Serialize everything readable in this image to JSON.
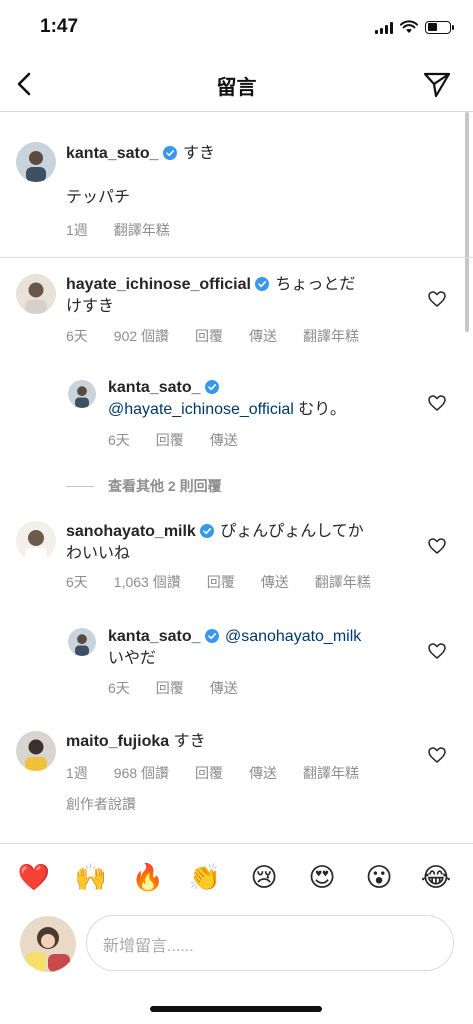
{
  "status_bar": {
    "time": "1:47"
  },
  "header": {
    "title": "留言"
  },
  "caption": {
    "username": "kanta_sato_",
    "text": "すき",
    "body": "テッパチ",
    "time": "1週",
    "translate": "翻譯年糕"
  },
  "comments": [
    {
      "username": "hayate_ichinose_official",
      "text_line1": "ちょっとだ",
      "text_line2": "けすき",
      "time": "6天",
      "likes": "902 個讚",
      "reply": "回覆",
      "send": "傳送",
      "translate": "翻譯年糕"
    },
    {
      "username": "kanta_sato_",
      "mention": "@hayate_ichinose_official",
      "text": "むり。",
      "time": "6天",
      "reply": "回覆",
      "send": "傳送"
    },
    {
      "username": "sanohayato_milk",
      "text_line1": "ぴょんぴょんしてか",
      "text_line2": "わいいね",
      "time": "6天",
      "likes": "1,063 個讚",
      "reply": "回覆",
      "send": "傳送",
      "translate": "翻譯年糕"
    },
    {
      "username": "kanta_sato_",
      "mention": "@sanohayato_milk",
      "text": "いやだ",
      "time": "6天",
      "reply": "回覆",
      "send": "傳送"
    },
    {
      "username": "maito_fujioka",
      "text": "すき",
      "time": "1週",
      "likes": "968 個讚",
      "reply": "回覆",
      "send": "傳送",
      "translate": "翻譯年糕",
      "creator_liked": "創作者說讚"
    }
  ],
  "more_replies": "查看其他 2 則回覆",
  "emoji_bar": [
    "❤️",
    "🙌",
    "🔥",
    "👏",
    "😢",
    "😍",
    "😮",
    "😂"
  ],
  "composer": {
    "placeholder": "新增留言......"
  },
  "colors": {
    "verified": "#3897f0",
    "mention": "#00376b",
    "meta": "#8e8e8e",
    "border": "#dbdbdb"
  }
}
